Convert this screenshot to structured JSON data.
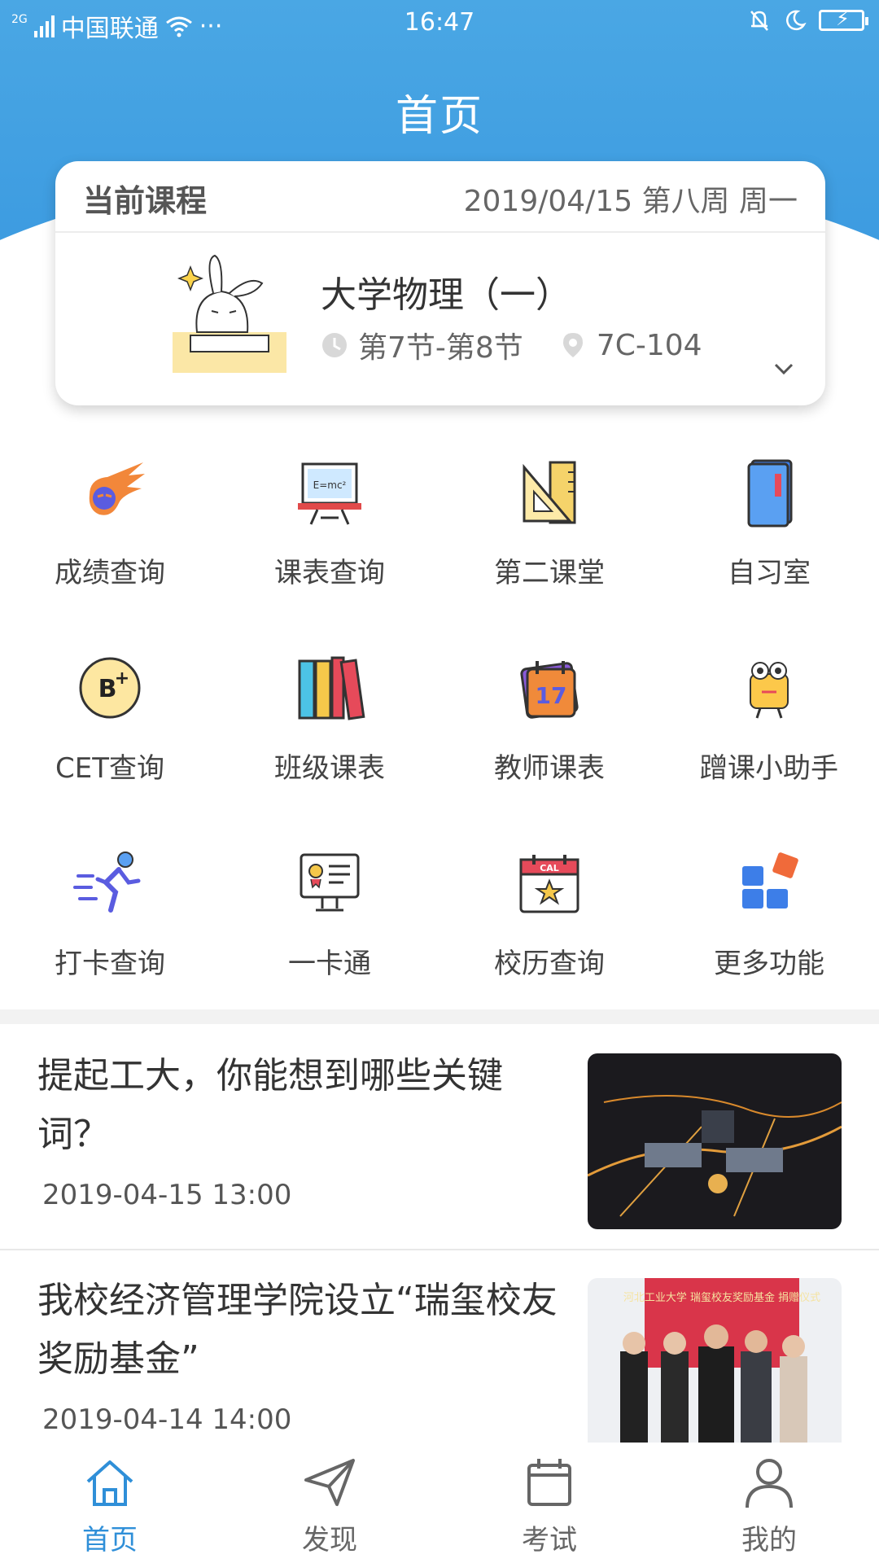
{
  "status_bar": {
    "network": "2G",
    "carrier": "中国联通",
    "dots": "···",
    "time": "16:47"
  },
  "header": {
    "title": "首页"
  },
  "current_course": {
    "label": "当前课程",
    "date_info": "2019/04/15 第八周 周一",
    "course_name": "大学物理（一）",
    "period": "第7节-第8节",
    "room": "7C-104"
  },
  "grid": [
    {
      "label": "成绩查询",
      "icon": "comet-grade-icon"
    },
    {
      "label": "课表查询",
      "icon": "blackboard-icon"
    },
    {
      "label": "第二课堂",
      "icon": "ruler-triangle-icon"
    },
    {
      "label": "自习室",
      "icon": "book-icon"
    },
    {
      "label": "CET查询",
      "icon": "b-plus-badge-icon"
    },
    {
      "label": "班级课表",
      "icon": "book-spines-icon"
    },
    {
      "label": "教师课表",
      "icon": "calendar-17-icon"
    },
    {
      "label": "蹭课小助手",
      "icon": "robot-helper-icon"
    },
    {
      "label": "打卡查询",
      "icon": "runner-icon"
    },
    {
      "label": "一卡通",
      "icon": "id-card-monitor-icon"
    },
    {
      "label": "校历查询",
      "icon": "calendar-star-icon"
    },
    {
      "label": "更多功能",
      "icon": "apps-grid-icon"
    }
  ],
  "news": [
    {
      "title": "提起工大，你能想到哪些关键词？",
      "time": "2019-04-15 13:00"
    },
    {
      "title": "我校经济管理学院设立“瑞玺校友奖励基金”",
      "time": "2019-04-14 14:00",
      "image_text": "河北工业大学 瑞玺校友奖励基金 捐赠仪式"
    }
  ],
  "bottom_nav": [
    {
      "label": "首页",
      "icon": "home-icon",
      "active": true
    },
    {
      "label": "发现",
      "icon": "paper-plane-icon",
      "active": false
    },
    {
      "label": "考试",
      "icon": "calendar-icon",
      "active": false
    },
    {
      "label": "我的",
      "icon": "user-icon",
      "active": false
    }
  ],
  "colors": {
    "header_blue": "#4aa7e4",
    "active_tab": "#2f8fd8"
  }
}
